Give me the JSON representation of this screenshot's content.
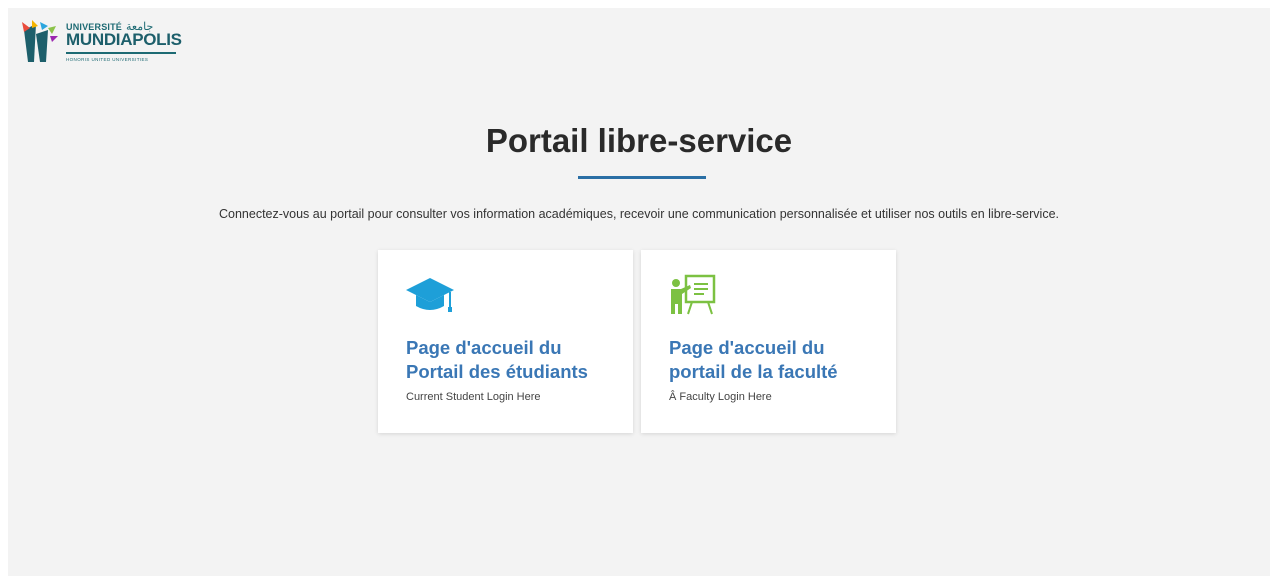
{
  "logo": {
    "top_line": "UNIVERSITÉ",
    "arabic": "جامعة",
    "name": "MUNDIAPOLIS",
    "tagline": "HONORIS UNITED UNIVERSITIES"
  },
  "main": {
    "title": "Portail libre-service",
    "intro": "Connectez-vous au portail pour consulter vos information académiques, recevoir une communication personnalisée et utiliser nos outils en libre-service."
  },
  "cards": [
    {
      "title": "Page d'accueil du Portail des étudiants",
      "subtitle": "Current Student Login Here",
      "icon": "graduation-cap-icon",
      "icon_color": "#1e9fd8"
    },
    {
      "title": "Page d'accueil du portail de la faculté",
      "subtitle": "Â Faculty Login Here",
      "icon": "teacher-board-icon",
      "icon_color": "#7cc142"
    }
  ],
  "colors": {
    "accent": "#2a6fa5",
    "card_title": "#3a77b5",
    "background": "#f3f3f3"
  }
}
